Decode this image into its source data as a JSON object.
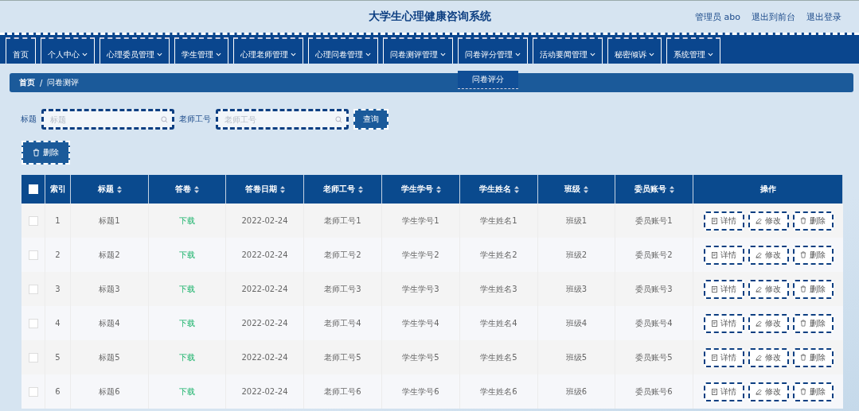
{
  "header": {
    "title": "大学生心理健康咨询系统",
    "links": [
      "管理员 abo",
      "退出到前台",
      "退出登录"
    ]
  },
  "nav": [
    {
      "label": "首页",
      "caret": false
    },
    {
      "label": "个人中心",
      "caret": true
    },
    {
      "label": "心理委员管理",
      "caret": true
    },
    {
      "label": "学生管理",
      "caret": true
    },
    {
      "label": "心理老师管理",
      "caret": true
    },
    {
      "label": "心理问卷管理",
      "caret": true
    },
    {
      "label": "问卷测评管理",
      "caret": true
    },
    {
      "label": "问卷评分管理",
      "caret": true,
      "submenu": [
        "问卷评分"
      ]
    },
    {
      "label": "活动要闻管理",
      "caret": true
    },
    {
      "label": "秘密倾诉",
      "caret": true
    },
    {
      "label": "系统管理",
      "caret": true
    }
  ],
  "breadcrumb": {
    "separator": "/",
    "items": [
      "首页",
      "问卷测评"
    ]
  },
  "search": [
    {
      "label": "标题",
      "placeholder": "标题"
    },
    {
      "label": "老师工号",
      "placeholder": "老师工号"
    }
  ],
  "query_button": "查询",
  "delete_button": "删除",
  "table": {
    "select_all": false,
    "columns": [
      {
        "label": "索引",
        "sortable": false
      },
      {
        "label": "标题",
        "sortable": true
      },
      {
        "label": "答卷",
        "sortable": true
      },
      {
        "label": "答卷日期",
        "sortable": true
      },
      {
        "label": "老师工号",
        "sortable": true
      },
      {
        "label": "学生学号",
        "sortable": true
      },
      {
        "label": "学生姓名",
        "sortable": true
      },
      {
        "label": "班级",
        "sortable": true
      },
      {
        "label": "委员账号",
        "sortable": true
      },
      {
        "label": "操作",
        "sortable": false
      }
    ],
    "rows": [
      {
        "checked": false,
        "cells": [
          "1",
          "标题1",
          "下载",
          "2022-02-24",
          "老师工号1",
          "学生学号1",
          "学生姓名1",
          "班级1",
          "委员账号1"
        ],
        "actions": [
          "详情",
          "修改",
          "删除"
        ]
      },
      {
        "checked": false,
        "cells": [
          "2",
          "标题2",
          "下载",
          "2022-02-24",
          "老师工号2",
          "学生学号2",
          "学生姓名2",
          "班级2",
          "委员账号2"
        ],
        "actions": [
          "详情",
          "修改",
          "删除"
        ]
      },
      {
        "checked": false,
        "cells": [
          "3",
          "标题3",
          "下载",
          "2022-02-24",
          "老师工号3",
          "学生学号3",
          "学生姓名3",
          "班级3",
          "委员账号3"
        ],
        "actions": [
          "详情",
          "修改",
          "删除"
        ]
      },
      {
        "checked": false,
        "cells": [
          "4",
          "标题4",
          "下载",
          "2022-02-24",
          "老师工号4",
          "学生学号4",
          "学生姓名4",
          "班级4",
          "委员账号4"
        ],
        "actions": [
          "详情",
          "修改",
          "删除"
        ]
      },
      {
        "checked": false,
        "cells": [
          "5",
          "标题5",
          "下载",
          "2022-02-24",
          "老师工号5",
          "学生学号5",
          "学生姓名5",
          "班级5",
          "委员账号5"
        ],
        "actions": [
          "详情",
          "修改",
          "删除"
        ]
      },
      {
        "checked": false,
        "cells": [
          "6",
          "标题6",
          "下载",
          "2022-02-24",
          "老师工号6",
          "学生学号6",
          "学生姓名6",
          "班级6",
          "委员账号6"
        ],
        "actions": [
          "详情",
          "修改",
          "删除"
        ]
      }
    ]
  }
}
